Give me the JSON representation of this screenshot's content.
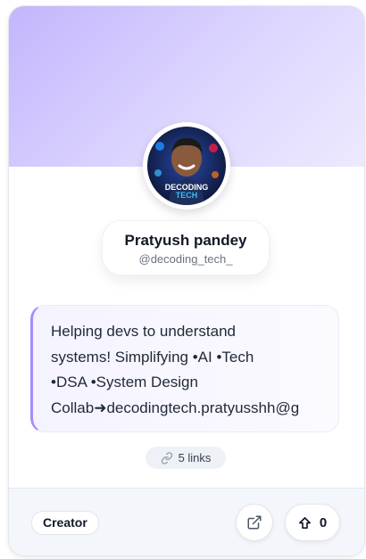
{
  "profile": {
    "name": "Pratyush pandey",
    "handle": "@decoding_tech_",
    "avatar_text": "DECODING TECH"
  },
  "bio": {
    "text": "Helping devs to understand\nsystems! Simplifying •AI •Tech\n•DSA •System Design\nCollab➜decodingtech.pratyusshh@g"
  },
  "links": {
    "label": "5 links",
    "icon": "link-icon"
  },
  "footer": {
    "badge": "Creator",
    "open_icon": "external-link-icon",
    "upvote_icon": "upvote-arrow-icon",
    "upvote_count": "0"
  },
  "colors": {
    "banner_start": "#c4b5fd",
    "banner_end": "#ede9fe",
    "accent": "#a78bfa"
  }
}
